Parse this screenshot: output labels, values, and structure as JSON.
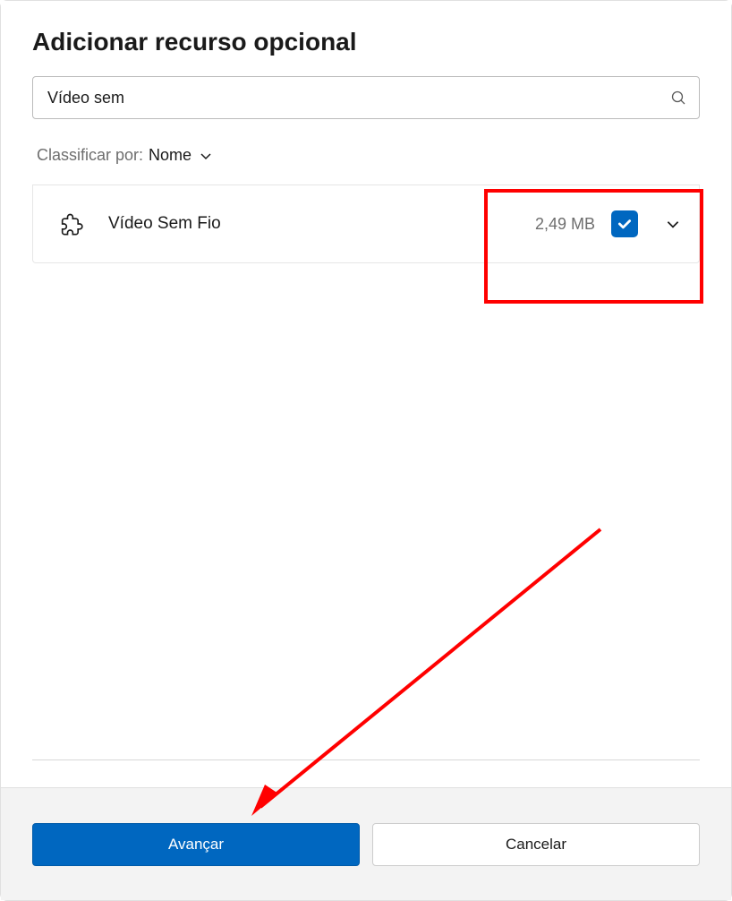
{
  "dialog": {
    "title": "Adicionar recurso opcional"
  },
  "search": {
    "value": "Vídeo sem"
  },
  "sort": {
    "label": "Classificar por:",
    "value": "Nome"
  },
  "features": [
    {
      "name": "Vídeo Sem Fio",
      "size": "2,49 MB",
      "checked": true
    }
  ],
  "footer": {
    "primary_label": "Avançar",
    "secondary_label": "Cancelar"
  }
}
